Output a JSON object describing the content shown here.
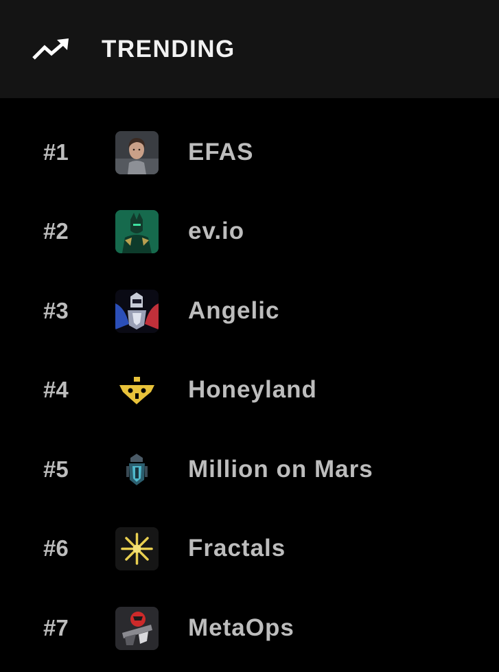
{
  "header": {
    "title": "TRENDING",
    "icon": "trending-up-icon"
  },
  "colors": {
    "header_bg": "#141414",
    "page_bg": "#000000",
    "text": "#bdbdbd",
    "title_text": "#f2f2f2"
  },
  "games": [
    {
      "rank": "#1",
      "name": "EFAS",
      "icon": "efas-avatar"
    },
    {
      "rank": "#2",
      "name": "ev.io",
      "icon": "evio-avatar"
    },
    {
      "rank": "#3",
      "name": "Angelic",
      "icon": "angelic-avatar"
    },
    {
      "rank": "#4",
      "name": "Honeyland",
      "icon": "honeyland-avatar"
    },
    {
      "rank": "#5",
      "name": "Million on Mars",
      "icon": "million-on-mars-avatar"
    },
    {
      "rank": "#6",
      "name": "Fractals",
      "icon": "fractals-avatar"
    },
    {
      "rank": "#7",
      "name": "MetaOps",
      "icon": "metaops-avatar"
    }
  ]
}
